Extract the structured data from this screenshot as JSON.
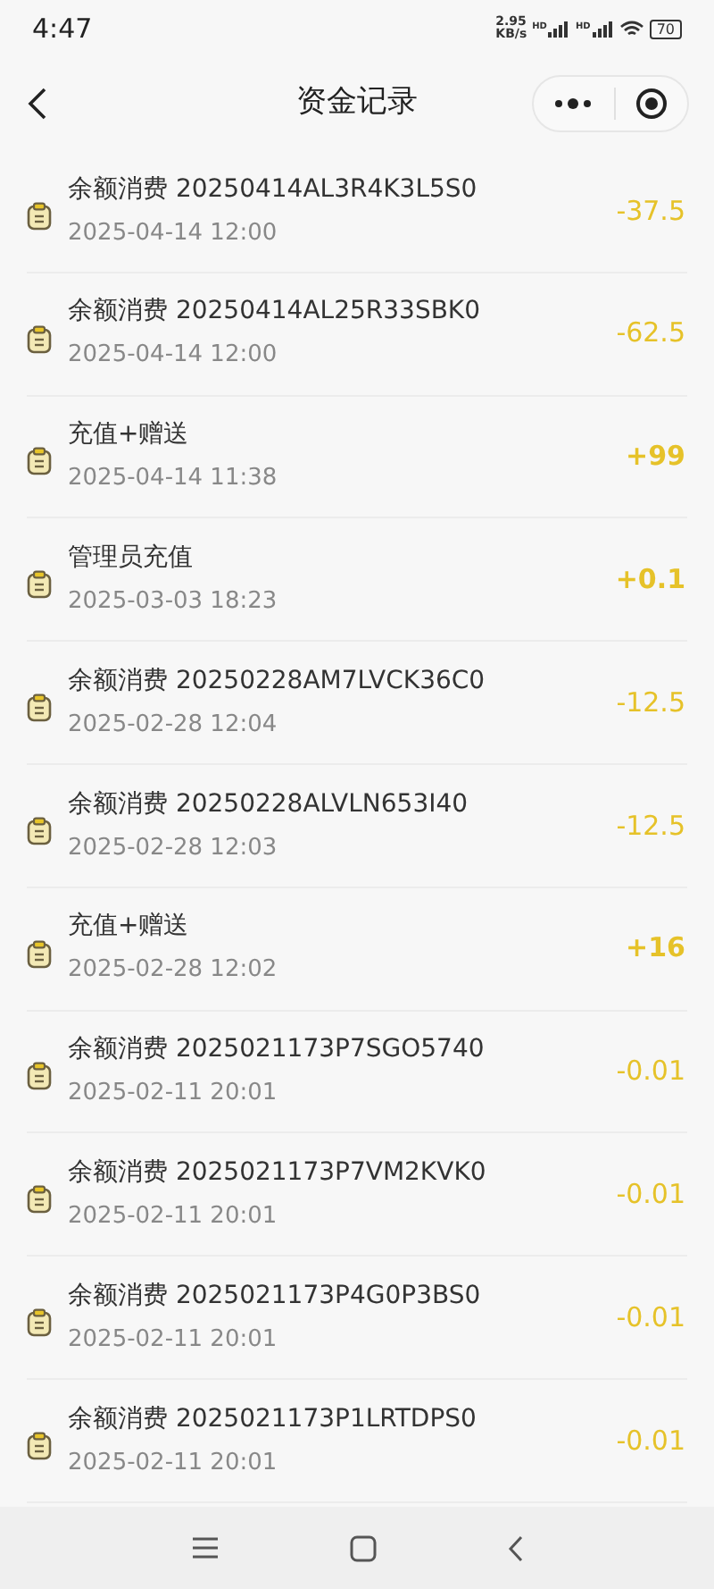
{
  "status_bar": {
    "time": "4:47",
    "speed": "2.95",
    "speed_unit": "KB/s",
    "network_labels": [
      "HD",
      "HD"
    ],
    "battery": "70"
  },
  "header": {
    "title": "资金记录"
  },
  "records": [
    {
      "title": "余额消费 20250414AL3R4K3L5S0",
      "time": "2025-04-14 12:00",
      "amount": "-37.5"
    },
    {
      "title": "余额消费 20250414AL25R33SBK0",
      "time": "2025-04-14 12:00",
      "amount": "-62.5"
    },
    {
      "title": "充值+赠送",
      "time": "2025-04-14 11:38",
      "amount": "+99"
    },
    {
      "title": "管理员充值",
      "time": "2025-03-03 18:23",
      "amount": "+0.1"
    },
    {
      "title": "余额消费 20250228AM7LVCK36C0",
      "time": "2025-02-28 12:04",
      "amount": "-12.5"
    },
    {
      "title": "余额消费 20250228ALVLN653I40",
      "time": "2025-02-28 12:03",
      "amount": "-12.5"
    },
    {
      "title": "充值+赠送",
      "time": "2025-02-28 12:02",
      "amount": "+16"
    },
    {
      "title": "余额消费 2025021173P7SGO5740",
      "time": "2025-02-11 20:01",
      "amount": "-0.01"
    },
    {
      "title": "余额消费 2025021173P7VM2KVK0",
      "time": "2025-02-11 20:01",
      "amount": "-0.01"
    },
    {
      "title": "余额消费 2025021173P4G0P3BS0",
      "time": "2025-02-11 20:01",
      "amount": "-0.01"
    },
    {
      "title": "余额消费 2025021173P1LRTDPS0",
      "time": "2025-02-11 20:01",
      "amount": "-0.01"
    }
  ]
}
